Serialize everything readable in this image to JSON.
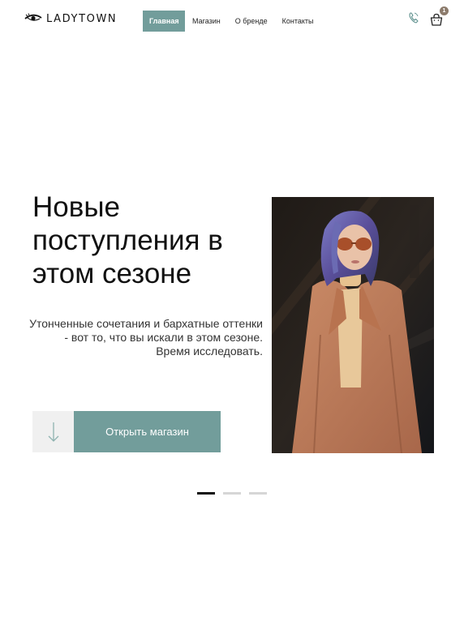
{
  "brand": {
    "name": "LADYTOWN"
  },
  "nav": {
    "items": [
      {
        "label": "Главная",
        "active": true
      },
      {
        "label": "Магазин",
        "active": false
      },
      {
        "label": "О бренде",
        "active": false
      },
      {
        "label": "Контакты",
        "active": false
      }
    ]
  },
  "header": {
    "phone_icon": "phone-icon",
    "cart_icon": "shopping-bag-icon",
    "cart_count": "1"
  },
  "hero": {
    "title": "Новые поступления в этом сезоне",
    "description": "Утонченные сочетания и бархатные оттенки - вот то, что вы искали в этом сезоне. Время исследовать.",
    "cta_label": "Открыть магазин",
    "cta_icon": "arrow-down-icon",
    "image_alt": "woman-in-coat-photo"
  },
  "slider": {
    "count": 3,
    "active_index": 0
  },
  "colors": {
    "accent": "#729d9b",
    "badge": "#8c7b6c",
    "text": "#111111",
    "dot_inactive": "#d6d6d6"
  }
}
